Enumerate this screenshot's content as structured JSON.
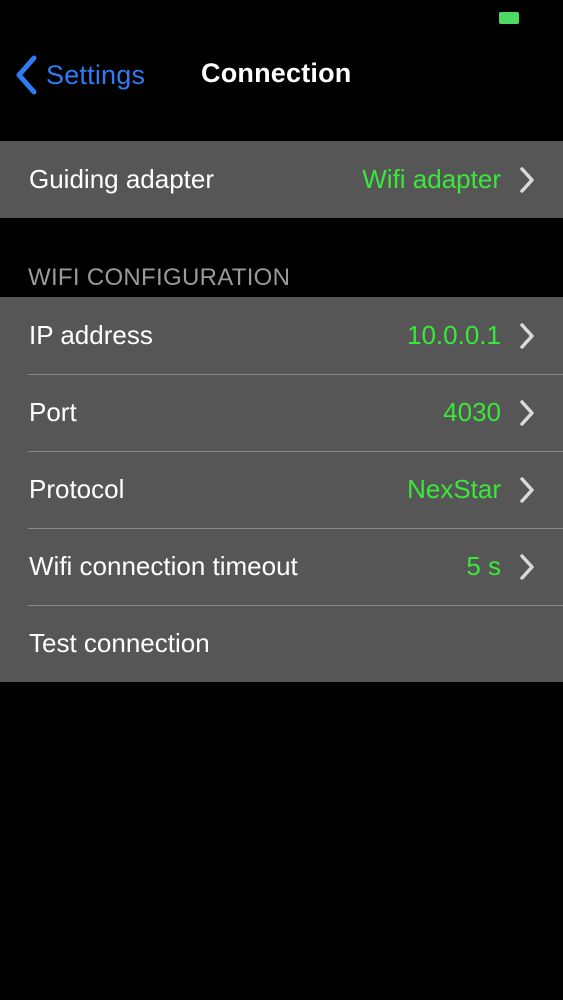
{
  "nav": {
    "back_label": "Settings",
    "title": "Connection"
  },
  "adapter_group": {
    "rows": [
      {
        "label": "Guiding adapter",
        "value": "Wifi adapter"
      }
    ]
  },
  "wifi_section": {
    "header": "WIFI CONFIGURATION",
    "rows": [
      {
        "label": "IP address",
        "value": "10.0.0.1"
      },
      {
        "label": "Port",
        "value": "4030"
      },
      {
        "label": "Protocol",
        "value": "NexStar"
      },
      {
        "label": "Wifi connection timeout",
        "value": "5 s"
      },
      {
        "label": "Test connection"
      }
    ]
  },
  "colors": {
    "accent_blue": "#2f7bf5",
    "value_green": "#39e83a",
    "row_background": "#565656",
    "battery_green": "#4cd964",
    "section_header": "#9a9a9a"
  },
  "icons": {
    "back": "chevron-left-icon",
    "disclosure": "chevron-right-icon",
    "battery": "battery-icon"
  }
}
